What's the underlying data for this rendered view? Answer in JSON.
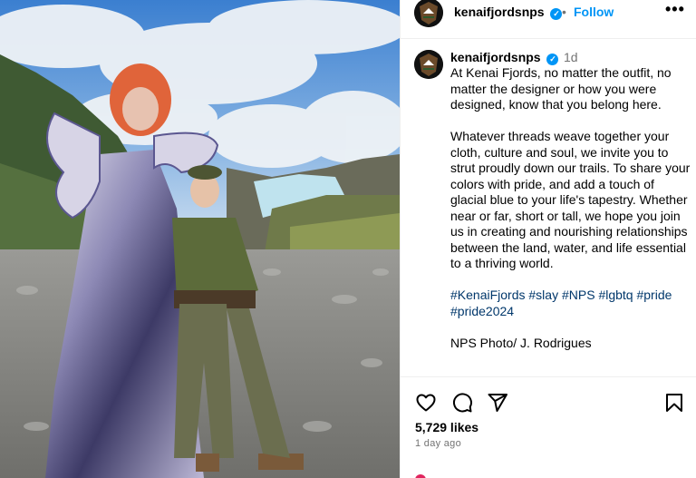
{
  "post": {
    "username": "kenaifjordsnps",
    "verified_icon": "verified-badge-icon",
    "follow_label": "Follow",
    "dot_separator": "•",
    "more_label": "•••",
    "time_short": "1d",
    "caption_paragraph_1": "At Kenai Fjords, no matter the outfit, no matter the designer or how you were designed, know that you belong here.",
    "caption_paragraph_2": "Whatever threads weave together your cloth, culture and soul, we invite you to strut proudly down our trails. To share your colors with pride, and add a touch of glacial blue to your life's tapestry. Whether near or far, short or tall, we hope you join us in creating and nourishing relationships between the land, water, and life essential to a thriving world.",
    "hashtags": [
      "#KenaiFjords",
      "#slay",
      "#NPS",
      "#lgbtq",
      "#pride",
      "#pride2024"
    ],
    "photo_credit": "NPS Photo/ J. Rodrigues",
    "likes": "5,729 likes",
    "time_ago": "1 day ago"
  },
  "icons": {
    "like": "heart-icon",
    "comment": "comment-icon",
    "share": "send-icon",
    "save": "bookmark-icon"
  },
  "colors": {
    "link_blue": "#0095f6",
    "hashtag": "#00376b",
    "muted": "#737373",
    "divider": "#efefef"
  }
}
